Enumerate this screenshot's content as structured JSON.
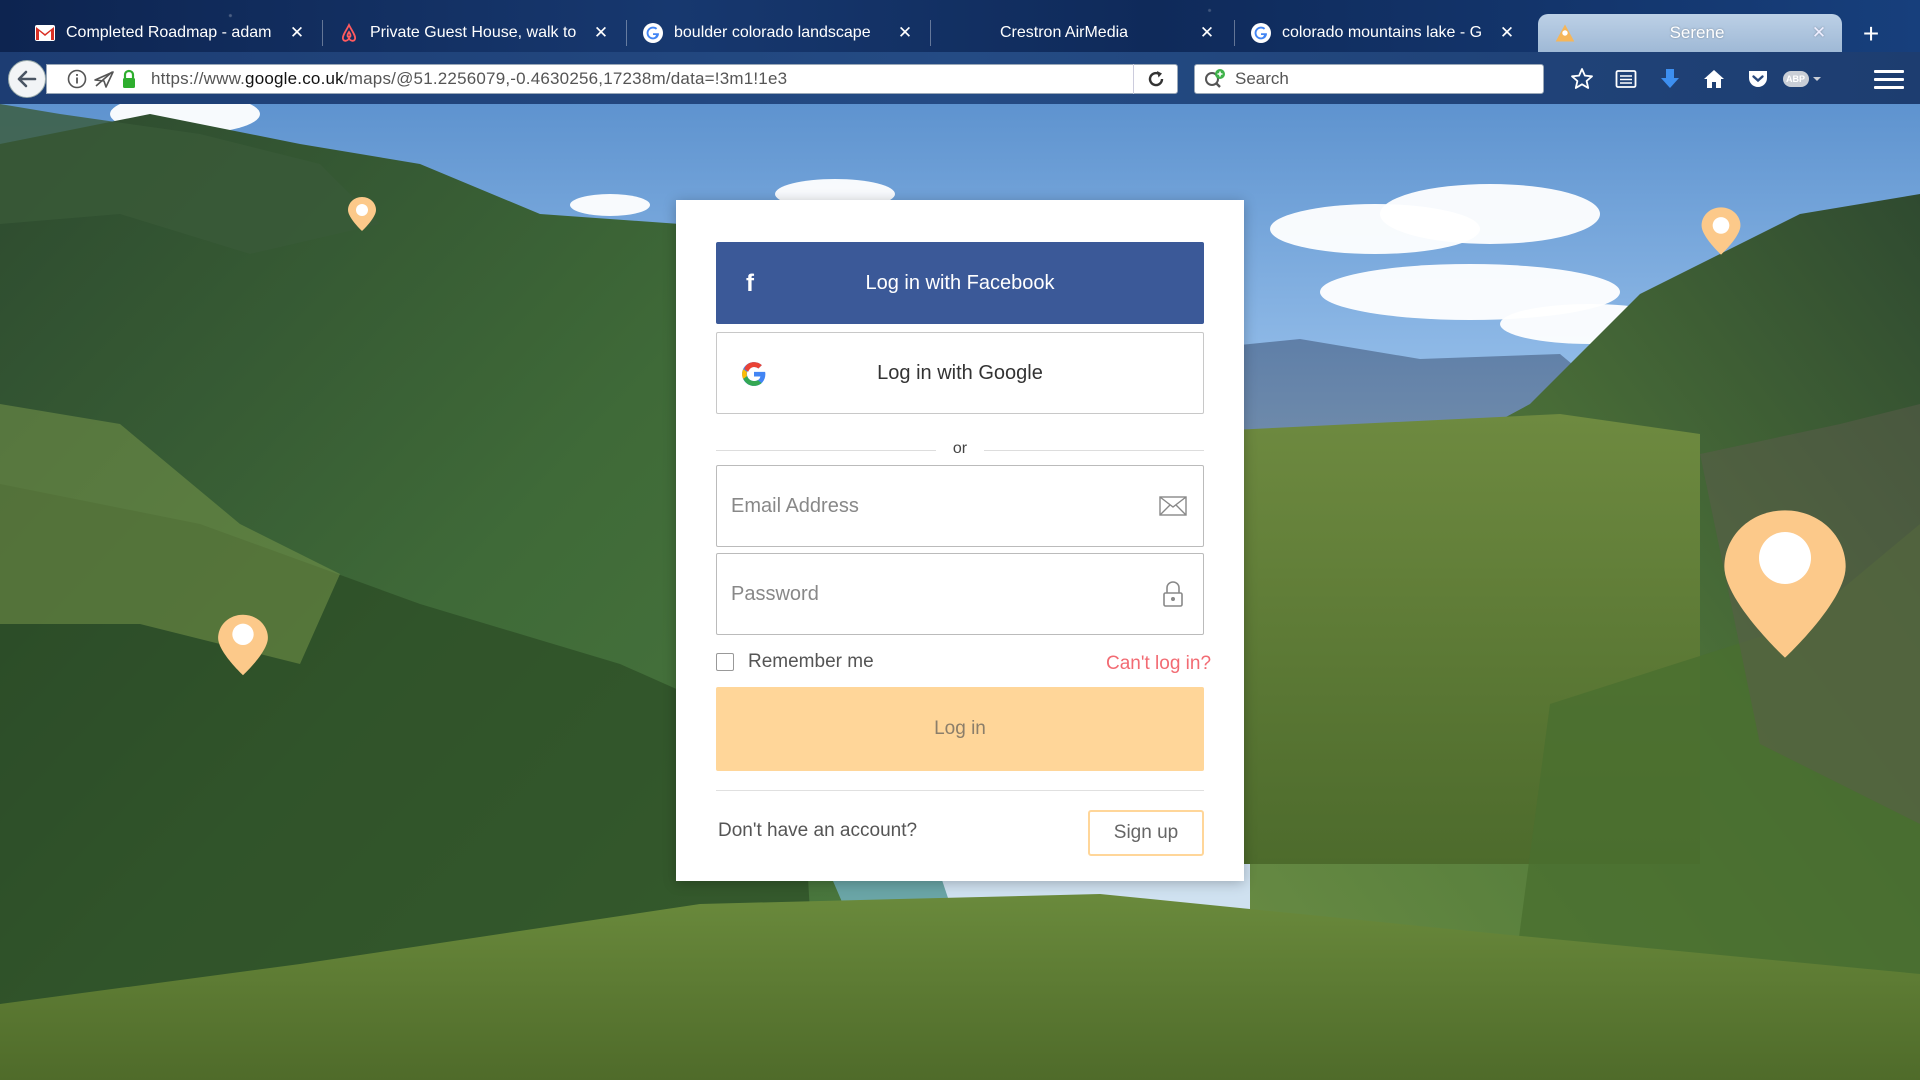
{
  "browser": {
    "tabs": [
      {
        "title": "Completed Roadmap - adam",
        "favicon": "gmail-icon",
        "active": false
      },
      {
        "title": "Private Guest House, walk to",
        "favicon": "airbnb-icon",
        "active": false
      },
      {
        "title": "boulder colorado landscape",
        "favicon": "google-icon",
        "active": false
      },
      {
        "title": "Crestron AirMedia",
        "favicon": "",
        "active": false
      },
      {
        "title": "colorado mountains lake - G",
        "favicon": "google-icon",
        "active": false
      },
      {
        "title": "Serene",
        "favicon": "serene-icon",
        "active": true
      }
    ],
    "new_tab_label": "+",
    "url_prefix": "https://www.",
    "url_domain": "google.co.uk",
    "url_suffix": "/maps/@51.2256079,-0.4630256,17238m/data=!3m1!1e3",
    "search_placeholder": "Search",
    "abp_label": "ABP",
    "colors": {
      "tab_accent": "#f5b65a"
    }
  },
  "login": {
    "facebook_icon": "f",
    "facebook_label": "Log in with Facebook",
    "google_label": "Log in with Google",
    "divider_text": "or",
    "email_placeholder": "Email Address",
    "password_placeholder": "Password",
    "remember_label": "Remember me",
    "forgot_link": "Can't log in?",
    "login_button": "Log in",
    "no_account_text": "Don't have an account?",
    "signup_button": "Sign up",
    "colors": {
      "facebook": "#3b5998",
      "login_button": "#ffd699",
      "forgot_link": "#f26b73",
      "pin": "#fcc98a"
    }
  }
}
